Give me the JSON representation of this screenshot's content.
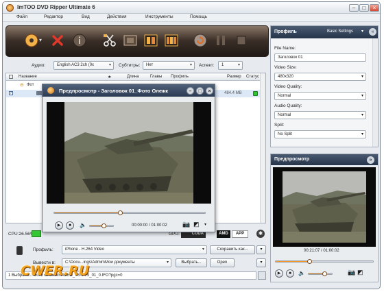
{
  "app": {
    "title": "ImTOO DVD Ripper Ultimate 6"
  },
  "menu": [
    "Файл",
    "Редактор",
    "Вид",
    "Действия",
    "Инструменты",
    "Помощь"
  ],
  "params": {
    "audio_label": "Аудио:",
    "audio_value": "English AC3 2ch (0x",
    "subs_label": "Субтитры:",
    "subs_value": "Нет",
    "aspect_label": "Аспект:",
    "aspect_value": "1"
  },
  "list": {
    "headers": {
      "name": "Название",
      "star": "★",
      "length": "Длина",
      "chapters": "Главы",
      "profile": "Профиль",
      "size": "Размер",
      "status": "Статус"
    },
    "folder_label": "Фот",
    "row_size": "484.4 MB"
  },
  "preview_window": {
    "title": "Предпросмотр - Заголовок 01_Фото Олежк",
    "time": "00:00:00 / 01:00:02",
    "progress": 0.44,
    "volume": 0.62
  },
  "status": {
    "cpu": "CPU:26.56%",
    "gpu_label": "GPU:",
    "cuda": "CUDA",
    "amd": "AMD",
    "app": "APP"
  },
  "bottom": {
    "profile_label": "Профиль:",
    "profile_value": "iPhone - H.264 Video",
    "save_as": "Сохранить как...",
    "dest_label": "Вывести в:",
    "dest_value": "C:\\Docu...ings\\Admin\\Мои документы",
    "browse": "Выбрать...",
    "open": "Open",
    "path": "1 Выбрано... Фото Олежки\\VIDEO_TS\\VTS_01_0.IFO?pgc=0"
  },
  "right_panel": {
    "title": "Профиль",
    "settings": "Basic Settings",
    "fields": [
      {
        "label": "File Name:",
        "value": "Заголовок 01"
      },
      {
        "label": "Video Size:",
        "value": "480x320"
      },
      {
        "label": "Video Quality:",
        "value": "Normal"
      },
      {
        "label": "Audio Quality:",
        "value": "Normal"
      },
      {
        "label": "Split:",
        "value": "No Split"
      }
    ]
  },
  "right_preview": {
    "title": "Предпросмотр",
    "time": "00:21:07 / 01:00:02",
    "progress": 0.35
  },
  "watermark": "CWER.RU",
  "colors": {
    "accent": "#e27a12",
    "dark_header": "#2b3a53",
    "toolbar": "#3b2f28"
  }
}
